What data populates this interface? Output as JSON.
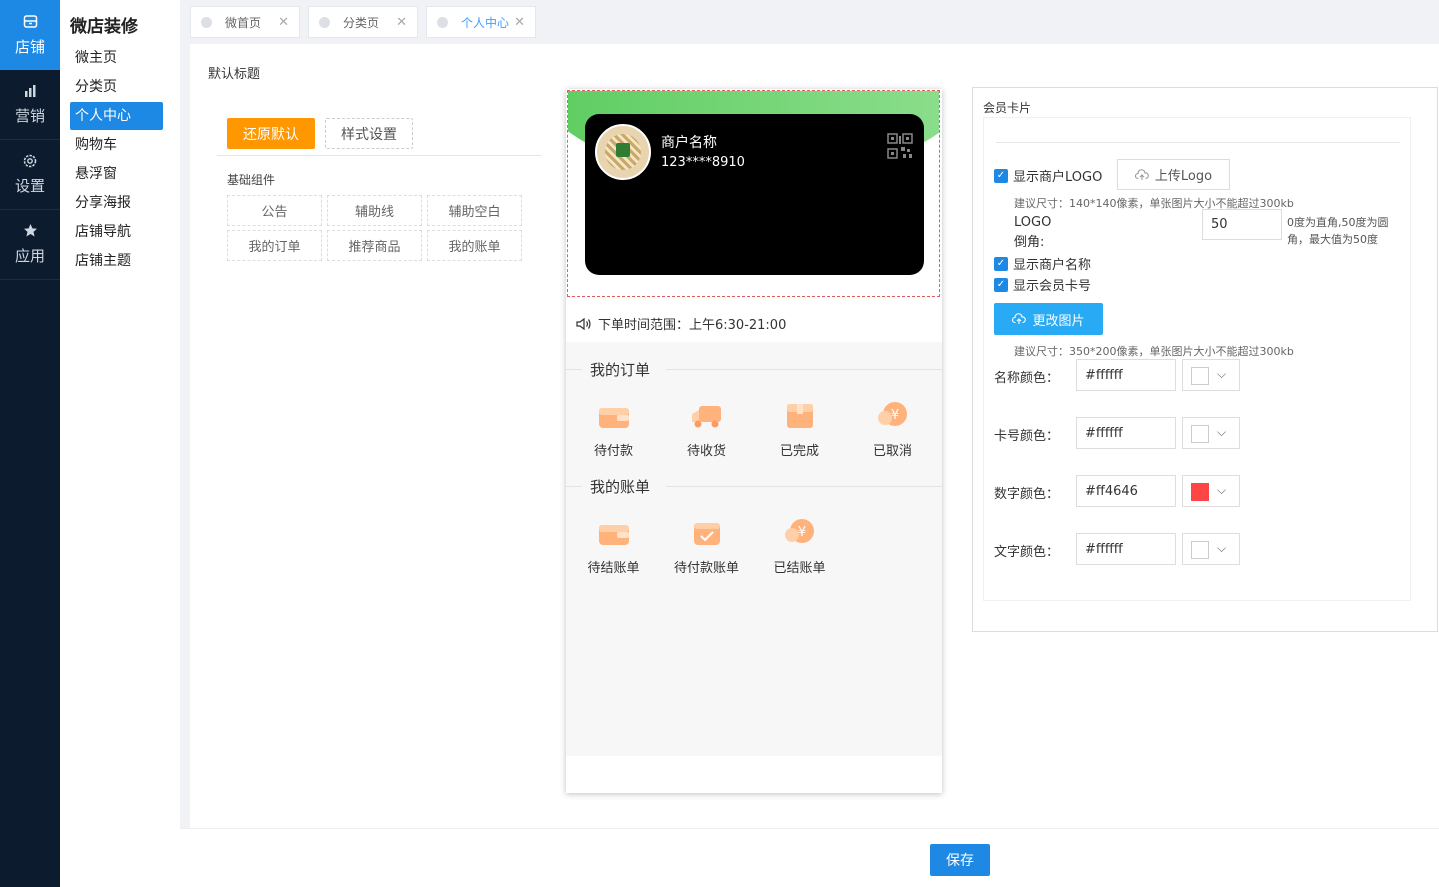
{
  "nav_primary": [
    {
      "label": "店铺",
      "icon": "shop-icon"
    },
    {
      "label": "营销",
      "icon": "bar-chart-icon"
    },
    {
      "label": "设置",
      "icon": "gear-icon"
    },
    {
      "label": "应用",
      "icon": "star-icon"
    }
  ],
  "nav_secondary": {
    "title": "微店装修",
    "items": [
      "微主页",
      "分类页",
      "个人中心",
      "购物车",
      "悬浮窗",
      "分享海报",
      "店铺导航",
      "店铺主题"
    ]
  },
  "tabs": [
    "微首页",
    "分类页",
    "个人中心"
  ],
  "page": {
    "heading": "默认标题"
  },
  "actions": {
    "restore": "还原默认",
    "style": "样式设置"
  },
  "components": {
    "section_label": "基础组件",
    "items": [
      "公告",
      "辅助线",
      "辅助空白",
      "我的订单",
      "推荐商品",
      "我的账单"
    ]
  },
  "preview": {
    "merchant_name": "商户名称",
    "card_number": "123****8910",
    "notice": "下单时间范围：上午6:30-21:00",
    "orders": {
      "title": "我的订单",
      "items": [
        "待付款",
        "待收货",
        "已完成",
        "已取消"
      ]
    },
    "bills": {
      "title": "我的账单",
      "items": [
        "待结账单",
        "待付款账单",
        "已结账单"
      ]
    }
  },
  "settings": {
    "title": "会员卡片",
    "show_logo": "显示商户LOGO",
    "upload_logo": "上传Logo",
    "logo_hint": "建议尺寸：140*140像素，单张图片大小不能超过300kb",
    "radius_label": "LOGO倒角:",
    "radius_value": "50",
    "radius_hint": "0度为直角,50度为圆角，最大值为50度",
    "show_name": "显示商户名称",
    "show_card_no": "显示会员卡号",
    "change_image": "更改图片",
    "image_hint": "建议尺寸：350*200像素，单张图片大小不能超过300kb",
    "colors": [
      {
        "label": "名称颜色：",
        "value": "#ffffff"
      },
      {
        "label": "卡号颜色：",
        "value": "#ffffff"
      },
      {
        "label": "数字颜色：",
        "value": "#ff4646"
      },
      {
        "label": "文字颜色：",
        "value": "#ffffff"
      }
    ]
  },
  "footer": {
    "save": "保存"
  },
  "theme": {
    "accent": "#1e88e5",
    "orange": "#ff9800",
    "green": "#5ccc5f",
    "light_blue": "#29aaf4"
  }
}
